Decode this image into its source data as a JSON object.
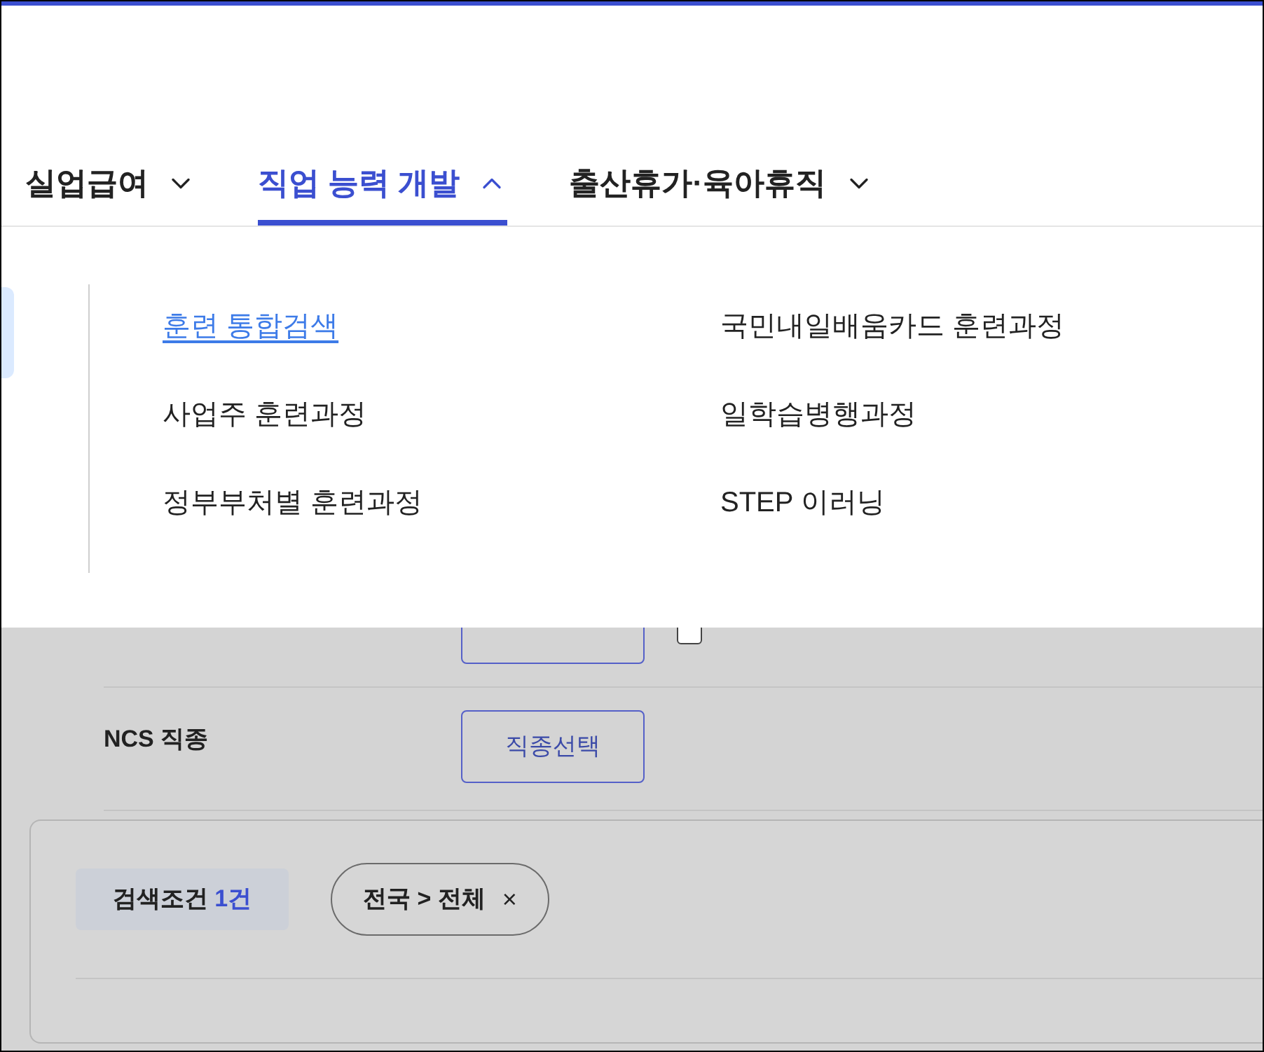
{
  "nav": {
    "tabs": [
      {
        "label": "실업급여",
        "selected": false,
        "expanded": false
      },
      {
        "label": "직업 능력 개발",
        "selected": true,
        "expanded": true
      },
      {
        "label": "출산휴가·육아휴직",
        "selected": false,
        "expanded": false
      }
    ]
  },
  "menu": {
    "items": [
      {
        "label": "훈련 통합검색",
        "selected": true
      },
      {
        "label": "국민내일배움카드 훈련과정",
        "selected": false
      },
      {
        "label": "사업주 훈련과정",
        "selected": false
      },
      {
        "label": "일학습병행과정",
        "selected": false
      },
      {
        "label": "정부부처별 훈련과정",
        "selected": false
      },
      {
        "label": "STEP 이러닝",
        "selected": false
      }
    ]
  },
  "filters": {
    "covered_row": {
      "checked": false
    },
    "rows": [
      {
        "label": "NCS 직종",
        "button": "직종선택"
      }
    ]
  },
  "search_conditions": {
    "label": "검색조건",
    "count": "1건",
    "chips": [
      {
        "label": "전국 > 전체",
        "remove": "×"
      }
    ]
  }
}
